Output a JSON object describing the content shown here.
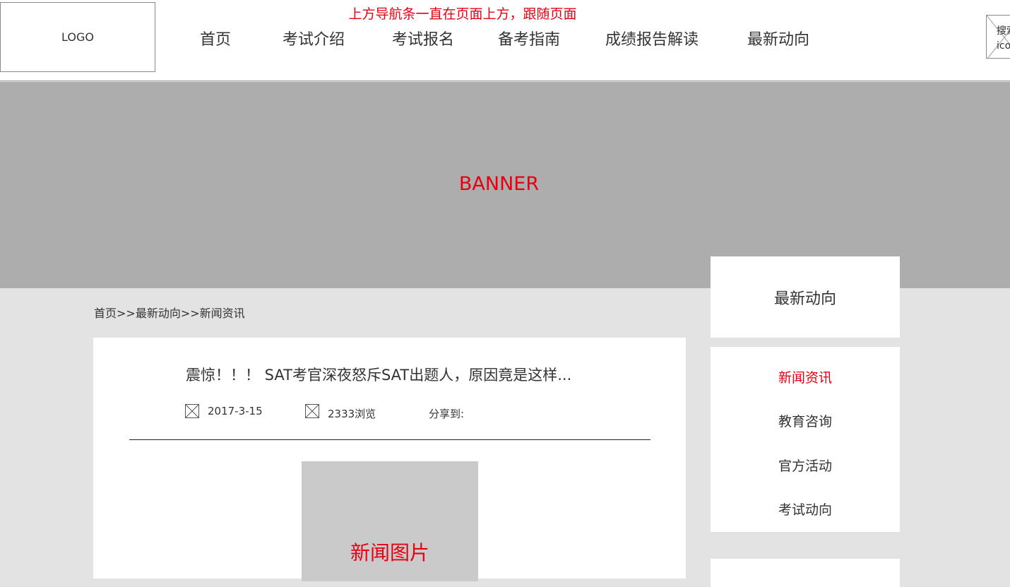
{
  "header": {
    "logo": "LOGO",
    "annotation": "上方导航条一直在页面上方，跟随页面",
    "nav": [
      "首页",
      "考试介绍",
      "考试报名",
      "备考指南",
      "成绩报告解读",
      "最新动向"
    ],
    "search_label": "搜索icon"
  },
  "banner": {
    "label": "BANNER"
  },
  "breadcrumb": "首页>>最新动向>>新闻资讯",
  "article": {
    "title": "震惊！！！ SAT考官深夜怒斥SAT出题人，原因竟是这样...",
    "date": "2017-3-15",
    "views": "2333浏览",
    "share_label": "分享到:",
    "image_label": "新闻图片"
  },
  "sidebar": {
    "title": "最新动向",
    "items": [
      {
        "label": "新闻资讯",
        "active": true
      },
      {
        "label": "教育咨询",
        "active": false
      },
      {
        "label": "官方活动",
        "active": false
      },
      {
        "label": "考试动向",
        "active": false
      }
    ]
  },
  "colors": {
    "accent": "#e60012",
    "banner": "#adadad",
    "page_bg": "#e3e3e3",
    "image_placeholder": "#cacaca"
  }
}
